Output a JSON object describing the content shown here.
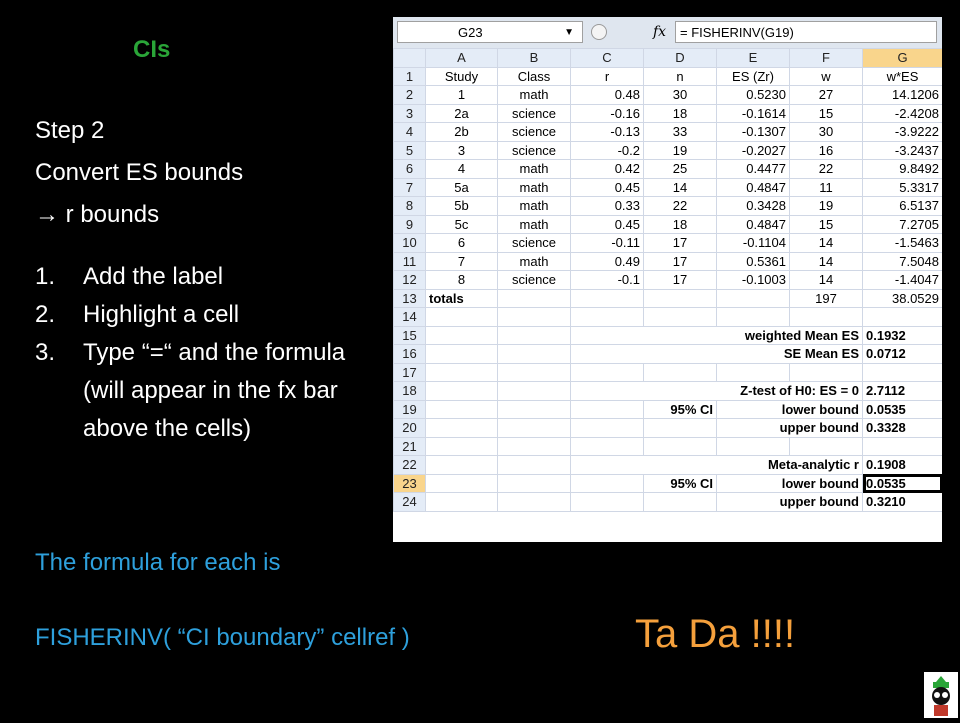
{
  "slide": {
    "title": "CIs",
    "step_lines": [
      "Step 2",
      "Convert ES bounds",
      "→ r bounds"
    ],
    "steps": [
      {
        "num": "1.",
        "text": "Add the label"
      },
      {
        "num": "2.",
        "text": "Highlight a cell"
      },
      {
        "num": "3.",
        "text": "Type “=“ and the formula (will appear in the fx bar above the cells)"
      }
    ],
    "formula_intro": "The formula for each is",
    "formula_text": "FISHERINV( “CI boundary”  cellref )",
    "tada": "Ta Da !!!!"
  },
  "spreadsheet": {
    "name_box": "G23",
    "formula": "= FISHERINV(G19)",
    "fx_label": "fx",
    "columns": [
      "A",
      "B",
      "C",
      "D",
      "E",
      "F",
      "G"
    ],
    "header_row": [
      "Study",
      "Class",
      "r",
      "n",
      "ES (Zr)",
      "w",
      "w*ES"
    ],
    "data_rows": [
      [
        "1",
        "math",
        "0.48",
        "30",
        "0.5230",
        "27",
        "14.1206"
      ],
      [
        "2a",
        "science",
        "-0.16",
        "18",
        "-0.1614",
        "15",
        "-2.4208"
      ],
      [
        "2b",
        "science",
        "-0.13",
        "33",
        "-0.1307",
        "30",
        "-3.9222"
      ],
      [
        "3",
        "science",
        "-0.2",
        "19",
        "-0.2027",
        "16",
        "-3.2437"
      ],
      [
        "4",
        "math",
        "0.42",
        "25",
        "0.4477",
        "22",
        "9.8492"
      ],
      [
        "5a",
        "math",
        "0.45",
        "14",
        "0.4847",
        "11",
        "5.3317"
      ],
      [
        "5b",
        "math",
        "0.33",
        "22",
        "0.3428",
        "19",
        "6.5137"
      ],
      [
        "5c",
        "math",
        "0.45",
        "18",
        "0.4847",
        "15",
        "7.2705"
      ],
      [
        "6",
        "science",
        "-0.11",
        "17",
        "-0.1104",
        "14",
        "-1.5463"
      ],
      [
        "7",
        "math",
        "0.49",
        "17",
        "0.5361",
        "14",
        "7.5048"
      ],
      [
        "8",
        "science",
        "-0.1",
        "17",
        "-0.1003",
        "14",
        "-1.4047"
      ]
    ],
    "totals": {
      "label": "totals",
      "w": "197",
      "wes": "38.0529"
    },
    "weighted_mean_label": "weighted Mean ES",
    "weighted_mean_value": "0.1932",
    "se_label": "SE Mean ES",
    "se_value": "0.0712",
    "ztest_label": "Z-test of H0: ES = 0",
    "ztest_value": "2.7112",
    "ci_label": "95% CI",
    "lower_label": "lower bound",
    "upper_label": "upper bound",
    "es_lower": "0.0535",
    "es_upper": "0.3328",
    "meta_r_label": "Meta-analytic r",
    "meta_r_value": "0.1908",
    "r_lower": "0.0535",
    "r_upper": "0.3210",
    "colors": {
      "green": "#2aa538",
      "blue": "#2ea0dc",
      "orange": "#f5a03c"
    }
  }
}
